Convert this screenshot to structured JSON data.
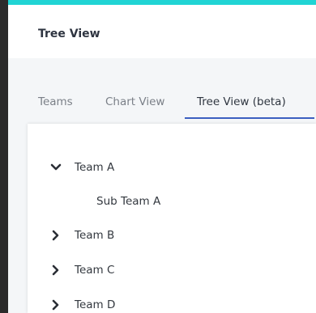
{
  "header": {
    "title": "Tree View"
  },
  "tabs": [
    {
      "label": "Teams",
      "active": false
    },
    {
      "label": "Chart View",
      "active": false
    },
    {
      "label": "Tree View (beta)",
      "active": true
    }
  ],
  "tree": {
    "nodes": [
      {
        "label": "Team A",
        "expanded": true,
        "icon": "chevron-down-icon"
      },
      {
        "label": "Sub Team A",
        "child": true
      },
      {
        "label": "Team B",
        "expanded": false,
        "icon": "chevron-right-icon"
      },
      {
        "label": "Team C",
        "expanded": false,
        "icon": "chevron-right-icon"
      },
      {
        "label": "Team D",
        "expanded": false,
        "icon": "chevron-right-icon"
      }
    ]
  },
  "colors": {
    "accent": "#20d4d4",
    "active_tab_underline": "#3b5fc0",
    "left_rail": "#2b2b2b"
  }
}
